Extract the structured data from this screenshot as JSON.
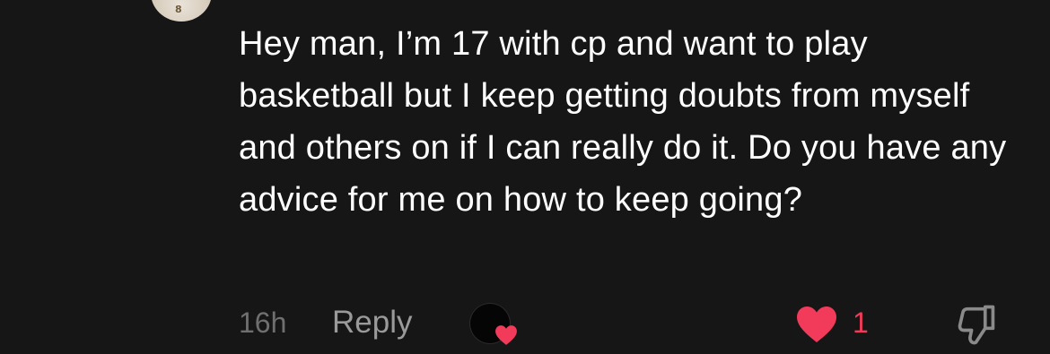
{
  "comment": {
    "avatar_icon": "user-avatar",
    "jersey_number": "8",
    "text": "Hey man, I’m 17 with cp and want to play basketball but I keep getting doubts from myself and others on if I can really do it. Do you have any advice for me on how to keep going?"
  },
  "actions": {
    "timestamp": "16h",
    "reply_label": "Reply",
    "creator_liked_icon": "creator-liked-avatar-heart",
    "like_icon": "heart-filled-icon",
    "like_count": "1",
    "dislike_icon": "thumbs-down-icon"
  },
  "colors": {
    "background": "#161616",
    "text": "#ffffff",
    "muted": "#6f6f6f",
    "reply": "#9a9a9a",
    "like_accent": "#f23a5a"
  }
}
